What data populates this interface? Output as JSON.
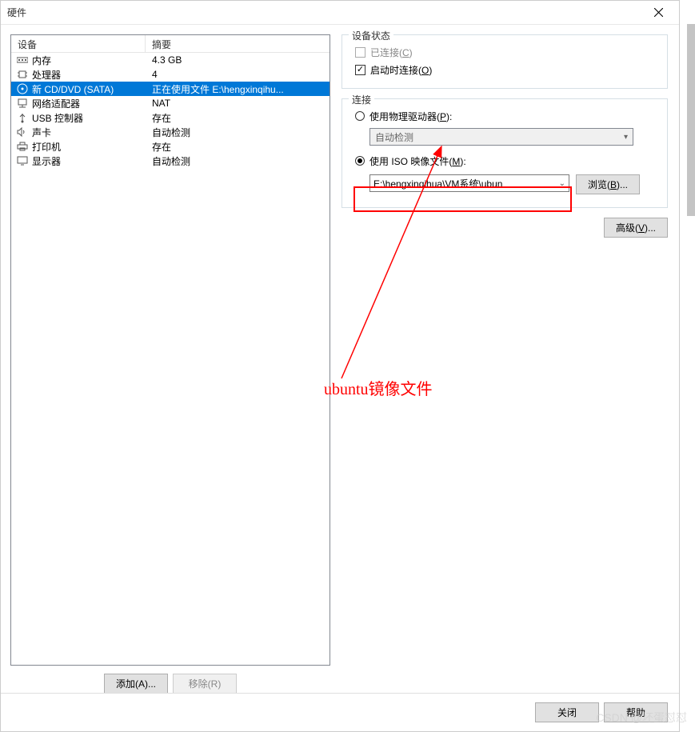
{
  "dialog": {
    "title": "硬件"
  },
  "list": {
    "header_device": "设备",
    "header_summary": "摘要",
    "rows": [
      {
        "icon": "memory",
        "name": "内存",
        "summary": "4.3 GB",
        "selected": false
      },
      {
        "icon": "cpu",
        "name": "处理器",
        "summary": "4",
        "selected": false
      },
      {
        "icon": "cd",
        "name": "新 CD/DVD (SATA)",
        "summary": "正在使用文件 E:\\hengxinqihu...",
        "selected": true
      },
      {
        "icon": "network",
        "name": "网络适配器",
        "summary": "NAT",
        "selected": false
      },
      {
        "icon": "usb",
        "name": "USB 控制器",
        "summary": "存在",
        "selected": false
      },
      {
        "icon": "sound",
        "name": "声卡",
        "summary": "自动检测",
        "selected": false
      },
      {
        "icon": "printer",
        "name": "打印机",
        "summary": "存在",
        "selected": false
      },
      {
        "icon": "display",
        "name": "显示器",
        "summary": "自动检测",
        "selected": false
      }
    ]
  },
  "buttons": {
    "add": "添加(A)...",
    "remove": "移除(R)"
  },
  "status_group": {
    "title": "设备状态",
    "connected": "已连接(C)",
    "connect_on_power": "启动时连接(O)"
  },
  "connection_group": {
    "title": "连接",
    "physical": "使用物理驱动器(P):",
    "physical_value": "自动检测",
    "iso": "使用 ISO 映像文件(M):",
    "iso_value": "E:\\hengxinqihua\\VM系统\\ubun",
    "browse": "浏览(B)..."
  },
  "advanced": "高级(V)...",
  "annotation": "ubuntu镜像文件",
  "bottom": {
    "close": "关闭",
    "help": "帮助"
  },
  "watermark": "CSDN @坏蛋怼怼"
}
